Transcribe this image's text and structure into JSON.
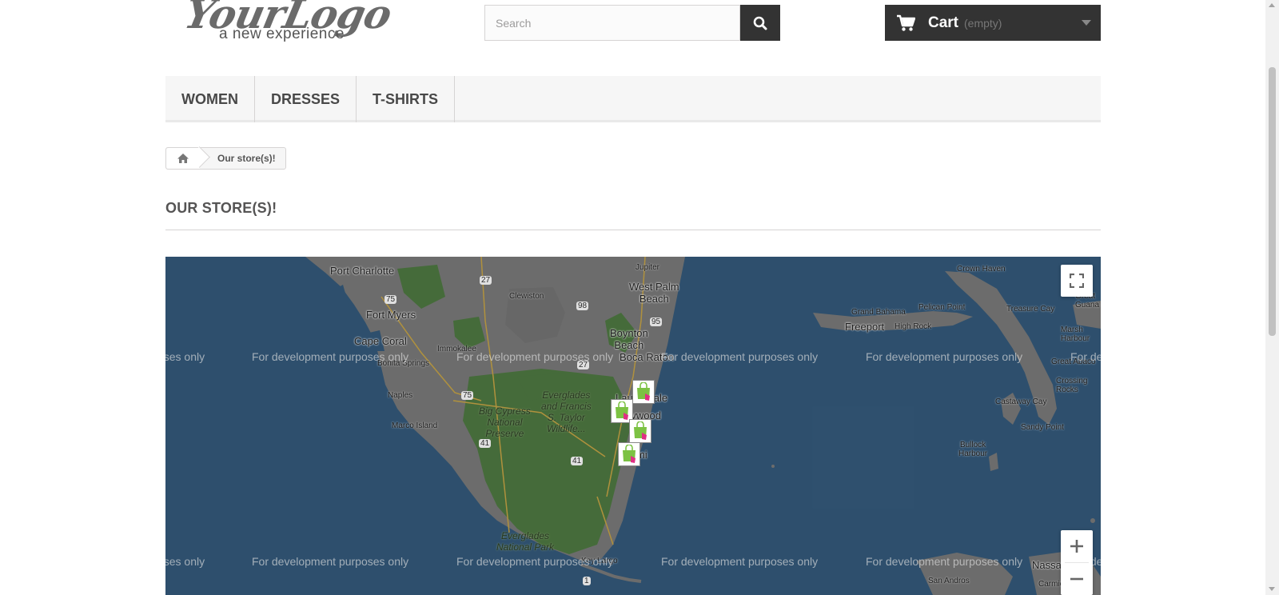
{
  "header": {
    "logo": {
      "script_text": "YourLogo",
      "tagline": "a new experience"
    },
    "search": {
      "placeholder": "Search",
      "value": ""
    },
    "cart": {
      "label": "Cart",
      "status": "(empty)"
    }
  },
  "nav": {
    "items": [
      {
        "label": "WOMEN"
      },
      {
        "label": "DRESSES"
      },
      {
        "label": "T-SHIRTS"
      }
    ]
  },
  "breadcrumb": {
    "current": "Our store(s)!"
  },
  "page": {
    "heading": "OUR STORE(S)!"
  },
  "map": {
    "watermark": "For development purposes only",
    "labels": {
      "port_charlotte": "Port Charlotte",
      "fort_myers": "Fort Myers",
      "cape_coral": "Cape Coral",
      "bonita_springs": "Bonita Springs",
      "naples": "Naples",
      "marco_island": "Marco Island",
      "clewiston": "Clewiston",
      "immokalee": "Immokalee",
      "jupiter": "Jupiter",
      "west_palm_beach": "West Palm\nBeach",
      "boynton_beach": "Boynton\nBeach",
      "boca_raton": "Boca Raton",
      "fort_lauderdale": "Lauderdale",
      "hollywood": "Hollywood",
      "miami": "Miami",
      "key_largo": "Key Largo",
      "big_cypress": "Big Cypress\nNational\nPreserve",
      "everglades_wildlife": "Everglades\nand Francis\nS. Taylor\nWildlife...",
      "everglades_np": "Everglades\nNational Park",
      "crown_haven": "Crown Haven",
      "grand_bahama": "Grand Bahama",
      "freeport": "Freeport",
      "high_rock": "High Rock",
      "pelican_point": "Pelican Point",
      "treasure_cay": "Treasure Cay",
      "great_guana_cay": "Great\nGuana Ca",
      "marsh_harbour": "Marsh\nHarbour",
      "great_abaco": "Great Abaco",
      "crossing_rocks": "Crossing\nRocks",
      "castaway_cay": "Castaway Cay",
      "sandy_point": "Sandy Point",
      "bullock_harbour": "Bullock\nHarbour",
      "nassau": "Nassa",
      "san_andros": "San Andros",
      "carmichael": "Carmichael"
    },
    "highways": [
      "27",
      "75",
      "98",
      "95",
      "27",
      "75",
      "41",
      "41",
      "1"
    ],
    "markers": 4
  },
  "colors": {
    "water": "#355b7d",
    "land": "#7c7c7c",
    "parkland": "#4f7a42",
    "header_dark": "#333333",
    "marker_bag": "#7cc243",
    "marker_hand": "#df2f84"
  },
  "icons": {
    "search": "search-icon",
    "cart": "cart-icon",
    "home": "home-icon",
    "fullscreen": "fullscreen-icon",
    "zoom_in": "zoom-in-icon",
    "zoom_out": "zoom-out-icon",
    "store_marker": "store-marker-icon"
  }
}
